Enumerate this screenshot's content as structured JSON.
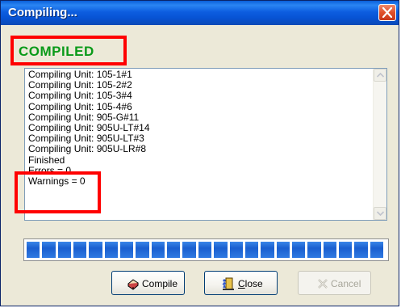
{
  "window": {
    "title": "Compiling..."
  },
  "status": {
    "text": "COMPILED",
    "color": "#0a9a19"
  },
  "log": {
    "lines": [
      "Compiling Unit: 105-1#1",
      "Compiling Unit: 105-2#2",
      "Compiling Unit: 105-3#4",
      "Compiling Unit: 105-4#6",
      "Compiling Unit: 905-G#11",
      "Compiling Unit: 905U-LT#14",
      "Compiling Unit: 905U-LT#3",
      "Compiling Unit: 905U-LR#8",
      "Finished",
      "Errors = 0",
      "Warnings = 0"
    ]
  },
  "progress": {
    "value": 1.0,
    "segments": 23,
    "color": "#1a5fcf"
  },
  "buttons": {
    "compile": {
      "label": "Compile",
      "icon": "compile-icon"
    },
    "close": {
      "label_first": "C",
      "label_rest": "lose",
      "icon": "door-exit-icon"
    },
    "cancel": {
      "label": "Cancel",
      "icon": "cancel-x-icon"
    }
  },
  "highlight_color": "#ff0000"
}
